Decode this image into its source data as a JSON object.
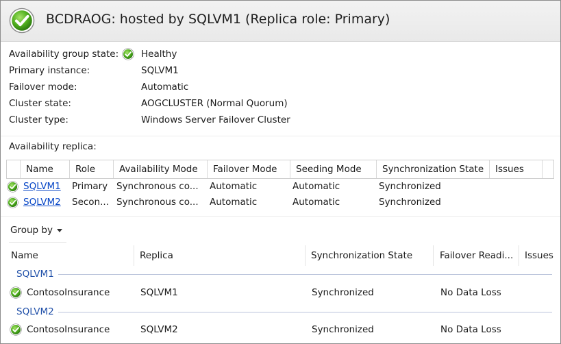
{
  "header": {
    "title": "BCDRAOG: hosted by SQLVM1 (Replica role: Primary)",
    "status_icon": "green-check-circle",
    "accent_color": "#4caf1a"
  },
  "properties": {
    "state_label": "Availability group state:",
    "state_value": "Healthy",
    "primary_label": "Primary instance:",
    "primary_value": "SQLVM1",
    "failover_label": "Failover mode:",
    "failover_value": "Automatic",
    "cluster_state_label": "Cluster state:",
    "cluster_state_value": "AOGCLUSTER (Normal Quorum)",
    "cluster_type_label": "Cluster type:",
    "cluster_type_value": "Windows Server Failover Cluster"
  },
  "replicas": {
    "section_label": "Availability replica:",
    "columns": [
      "Name",
      "Role",
      "Availability Mode",
      "Failover Mode",
      "Seeding Mode",
      "Synchronization State",
      "Issues"
    ],
    "rows": [
      {
        "name": "SQLVM1",
        "role": "Primary",
        "availability_mode": "Synchronous co...",
        "failover_mode": "Automatic",
        "seeding_mode": "Automatic",
        "sync_state": "Synchronized",
        "issues": ""
      },
      {
        "name": "SQLVM2",
        "role": "Secon...",
        "availability_mode": "Synchronous co...",
        "failover_mode": "Automatic",
        "seeding_mode": "Automatic",
        "sync_state": "Synchronized",
        "issues": ""
      }
    ]
  },
  "databases": {
    "group_by_label": "Group by",
    "columns": [
      "Name",
      "Replica",
      "Synchronization State",
      "Failover Readi...",
      "Issues"
    ],
    "groups": [
      {
        "label": "SQLVM1",
        "rows": [
          {
            "name": "ContosoInsurance",
            "replica": "SQLVM1",
            "sync_state": "Synchronized",
            "failover_readiness": "No Data Loss",
            "issues": ""
          }
        ]
      },
      {
        "label": "SQLVM2",
        "rows": [
          {
            "name": "ContosoInsurance",
            "replica": "SQLVM2",
            "sync_state": "Synchronized",
            "failover_readiness": "No Data Loss",
            "issues": ""
          }
        ]
      }
    ]
  }
}
